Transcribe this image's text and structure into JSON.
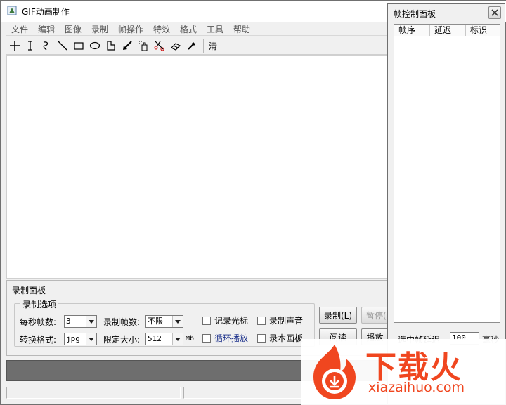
{
  "window": {
    "title": "GIF动画制作"
  },
  "menu": [
    "文件",
    "编辑",
    "图像",
    "录制",
    "帧操作",
    "特效",
    "格式",
    "工具",
    "帮助"
  ],
  "toolbar": {
    "icons": [
      "crosshair-icon",
      "text-cursor-icon",
      "freehand-icon",
      "line-icon",
      "rectangle-icon",
      "ellipse-icon",
      "polygon-icon",
      "arrow-icon",
      "spray-icon",
      "scissors-icon",
      "eraser-icon",
      "eyedropper-icon"
    ],
    "clear_label": "清"
  },
  "record_panel": {
    "title": "录制面板",
    "options_legend": "录制选项",
    "fps_label": "每秒帧数:",
    "fps_value": "3",
    "frame_count_label": "录制帧数:",
    "frame_count_value": "不限",
    "format_label": "转换格式:",
    "format_value": "jpg",
    "size_limit_label": "限定大小:",
    "size_limit_value": "512",
    "size_unit": "Mb",
    "record_cursor": "记录光标",
    "loop_play": "循环播放",
    "record_sound": "录制声音",
    "record_canvas": "录本画板",
    "record_button": "录制(L)",
    "pause_button": "暂停(",
    "read_button": "阅读",
    "play_button": "播放"
  },
  "frame_panel": {
    "title": "帧控制面板",
    "columns": [
      "帧序",
      "延迟",
      "标识"
    ],
    "footer_label": "选中帧延迟",
    "footer_value": "100",
    "footer_unit": "毫秒"
  },
  "watermark": {
    "brand": "下载火",
    "url": "xiazaihuo.com"
  },
  "colors": {
    "accent": "#f0461f",
    "progress": "#6e6e6e"
  }
}
